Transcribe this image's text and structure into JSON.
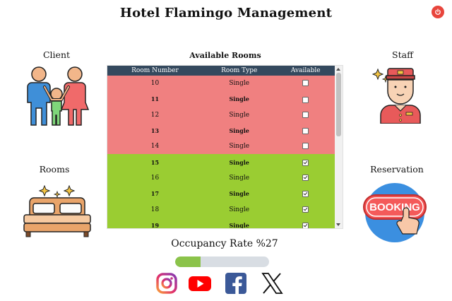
{
  "app": {
    "title": "Hotel Flamingo Management",
    "power_icon": "power-icon"
  },
  "sections": {
    "client": "Client",
    "staff": "Staff",
    "rooms": "Rooms",
    "reservation": "Reservation",
    "reservation_image_text": "BOOKING"
  },
  "rooms_table": {
    "caption": "Available Rooms",
    "columns": [
      "Room Number",
      "Room Type",
      "Available"
    ],
    "rows": [
      {
        "number": "10",
        "type": "Single",
        "available": false,
        "bold": false
      },
      {
        "number": "11",
        "type": "Single",
        "available": false,
        "bold": true
      },
      {
        "number": "12",
        "type": "Single",
        "available": false,
        "bold": false
      },
      {
        "number": "13",
        "type": "Single",
        "available": false,
        "bold": true
      },
      {
        "number": "14",
        "type": "Single",
        "available": false,
        "bold": false
      },
      {
        "number": "15",
        "type": "Single",
        "available": true,
        "bold": true
      },
      {
        "number": "16",
        "type": "Single",
        "available": true,
        "bold": false
      },
      {
        "number": "17",
        "type": "Single",
        "available": true,
        "bold": true
      },
      {
        "number": "18",
        "type": "Single",
        "available": true,
        "bold": false
      },
      {
        "number": "19",
        "type": "Single",
        "available": true,
        "bold": true
      }
    ],
    "colors": {
      "unavailable": "#f08080",
      "available": "#9acd32",
      "header": "#34495e"
    }
  },
  "occupancy": {
    "label": "Occupancy Rate %27",
    "rate_percent": 27,
    "fill_color": "#8bc34a"
  },
  "social": [
    "instagram-icon",
    "youtube-icon",
    "facebook-icon",
    "x-icon"
  ]
}
